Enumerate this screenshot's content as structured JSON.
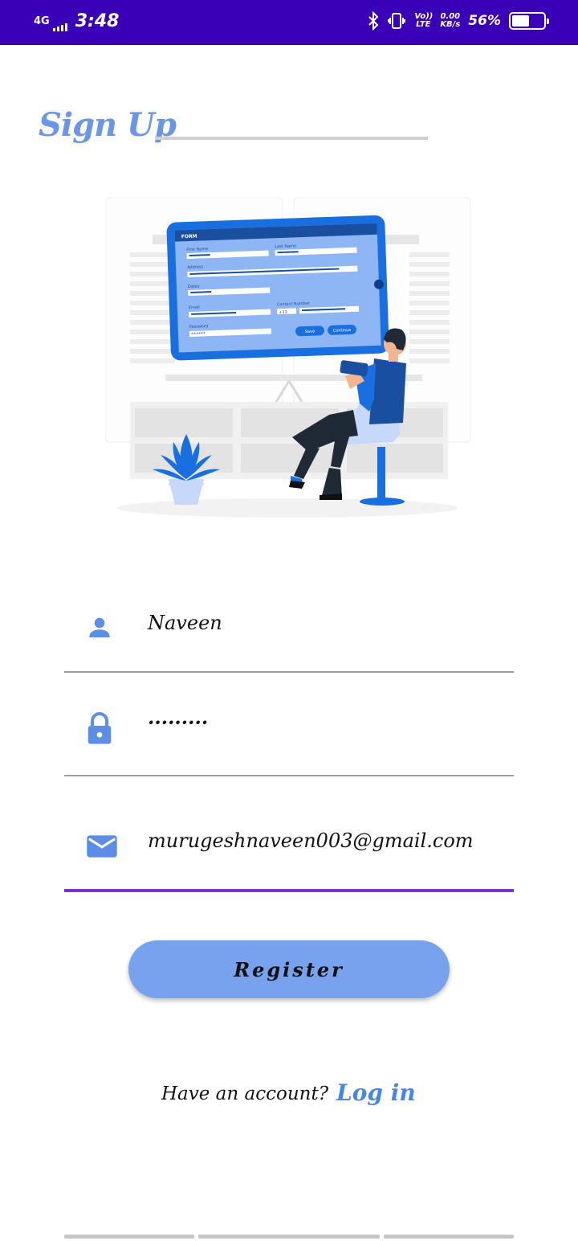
{
  "status_bar": {
    "network": "4G",
    "time": "3:48",
    "volte": "Vo)) LTE",
    "speed_value": "0.00",
    "speed_unit": "KB/s",
    "battery_percent": "56%",
    "battery_level": 0.56,
    "icons": [
      "bluetooth-icon",
      "vibrate-icon",
      "signal-icon",
      "battery-icon"
    ]
  },
  "header": {
    "title": "Sign Up"
  },
  "illustration": {
    "form_title": "FORM",
    "labels": [
      "First Name",
      "Last Name",
      "Address",
      "Dates",
      "Email",
      "Contact Number",
      "Password"
    ],
    "phone_code": "+33",
    "password_dots": "******",
    "save_label": "Save",
    "continue_label": "Continue"
  },
  "form": {
    "username": {
      "value": "Naveen",
      "icon": "person-icon"
    },
    "password": {
      "value": "·········",
      "icon": "lock-icon"
    },
    "email": {
      "value": "murugeshnaveen003@gmail.com",
      "icon": "mail-icon"
    }
  },
  "actions": {
    "register_label": "Register",
    "have_account_text": "Have an account?",
    "login_label": "Log in"
  },
  "colors": {
    "status_bar": "#3a00b8",
    "accent": "#6b95e8",
    "button": "#79a2ee",
    "focus_underline": "#7a2fd6",
    "link": "#4a86e0"
  }
}
